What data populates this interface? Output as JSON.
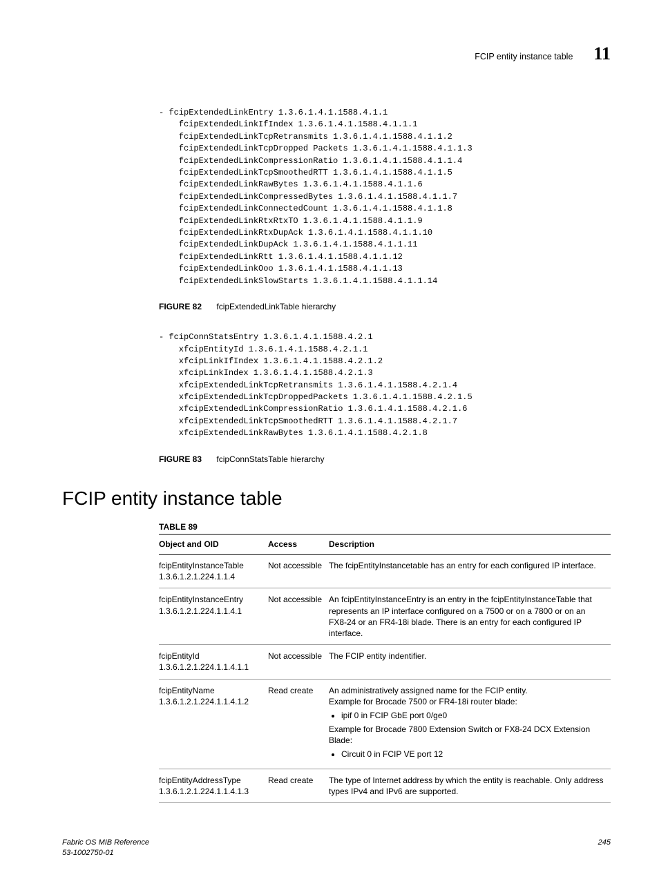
{
  "header": {
    "title": "FCIP entity instance table",
    "chapter": "11"
  },
  "figure82": {
    "label": "FIGURE 82",
    "title": "fcipExtendedLinkTable hierarchy",
    "code": "- fcipExtendedLinkEntry 1.3.6.1.4.1.1588.4.1.1\n    fcipExtendedLinkIfIndex 1.3.6.1.4.1.1588.4.1.1.1\n    fcipExtendedLinkTcpRetransmits 1.3.6.1.4.1.1588.4.1.1.2\n    fcipExtendedLinkTcpDropped Packets 1.3.6.1.4.1.1588.4.1.1.3\n    fcipExtendedLinkCompressionRatio 1.3.6.1.4.1.1588.4.1.1.4\n    fcipExtendedLinkTcpSmoothedRTT 1.3.6.1.4.1.1588.4.1.1.5\n    fcipExtendedLinkRawBytes 1.3.6.1.4.1.1588.4.1.1.6\n    fcipExtendedLinkCompressedBytes 1.3.6.1.4.1.1588.4.1.1.7\n    fcipExtendedLinkConnectedCount 1.3.6.1.4.1.1588.4.1.1.8\n    fcipExtendedLinkRtxRtxTO 1.3.6.1.4.1.1588.4.1.1.9\n    fcipExtendedLinkRtxDupAck 1.3.6.1.4.1.1588.4.1.1.10\n    fcipExtendedLinkDupAck 1.3.6.1.4.1.1588.4.1.1.11\n    fcipExtendedLinkRtt 1.3.6.1.4.1.1588.4.1.1.12\n    fcipExtendedLinkOoo 1.3.6.1.4.1.1588.4.1.1.13\n    fcipExtendedLinkSlowStarts 1.3.6.1.4.1.1588.4.1.1.14"
  },
  "figure83": {
    "label": "FIGURE 83",
    "title": "fcipConnStatsTable hierarchy",
    "code": "- fcipConnStatsEntry 1.3.6.1.4.1.1588.4.2.1\n    xfcipEntityId 1.3.6.1.4.1.1588.4.2.1.1\n    xfcipLinkIfIndex 1.3.6.1.4.1.1588.4.2.1.2\n    xfcipLinkIndex 1.3.6.1.4.1.1588.4.2.1.3\n    xfcipExtendedLinkTcpRetransmits 1.3.6.1.4.1.1588.4.2.1.4\n    xfcipExtendedLinkTcpDroppedPackets 1.3.6.1.4.1.1588.4.2.1.5\n    xfcipExtendedLinkCompressionRatio 1.3.6.1.4.1.1588.4.2.1.6\n    xfcipExtendedLinkTcpSmoothedRTT 1.3.6.1.4.1.1588.4.2.1.7\n    xfcipExtendedLinkRawBytes 1.3.6.1.4.1.1588.4.2.1.8"
  },
  "section": {
    "title": "FCIP entity instance table"
  },
  "table": {
    "label": "TABLE 89",
    "headers": {
      "obj": "Object and OID",
      "acc": "Access",
      "desc": "Description"
    },
    "rows": [
      {
        "obj_name": "fcipEntityInstanceTable",
        "obj_oid": "1.3.6.1.2.1.224.1.1.4",
        "access": "Not accessible",
        "desc_plain": "The fcipEntityInstancetable has an entry for each configured IP interface."
      },
      {
        "obj_name": "fcipEntityInstanceEntry",
        "obj_oid": "1.3.6.1.2.1.224.1.1.4.1",
        "access": "Not accessible",
        "desc_plain": "An fcipEntityInstanceEntry is an entry in the fcipEntityInstanceTable that represents an IP interface configured on a 7500 or on a 7800 or on an FX8-24 or an FR4-18i blade. There is an entry for each configured IP interface."
      },
      {
        "obj_name": "fcipEntityId",
        "obj_oid": "1.3.6.1.2.1.224.1.1.4.1.1",
        "access": "Not accessible",
        "desc_plain": "The FCIP entity indentifier."
      },
      {
        "obj_name": "fcipEntityName",
        "obj_oid": "1.3.6.1.2.1.224.1.1.4.1.2",
        "access": "Read create",
        "desc_rich": {
          "line1": "An administratively assigned name for the FCIP entity.",
          "line2": "Example for Brocade 7500 or FR4-18i router blade:",
          "bullet1": "ipif 0 in FCIP GbE port 0/ge0",
          "line3": "Example for Brocade 7800 Extension Switch or FX8-24 DCX Extension Blade:",
          "bullet2": "Circuit 0 in FCIP VE port 12"
        }
      },
      {
        "obj_name": "fcipEntityAddressType",
        "obj_oid": "1.3.6.1.2.1.224.1.1.4.1.3",
        "access": "Read create",
        "desc_plain": "The type of Internet address by which the entity is reachable. Only address types IPv4 and IPv6 are supported."
      }
    ]
  },
  "footer": {
    "left1": "Fabric OS MIB Reference",
    "left2": "53-1002750-01",
    "right": "245"
  }
}
